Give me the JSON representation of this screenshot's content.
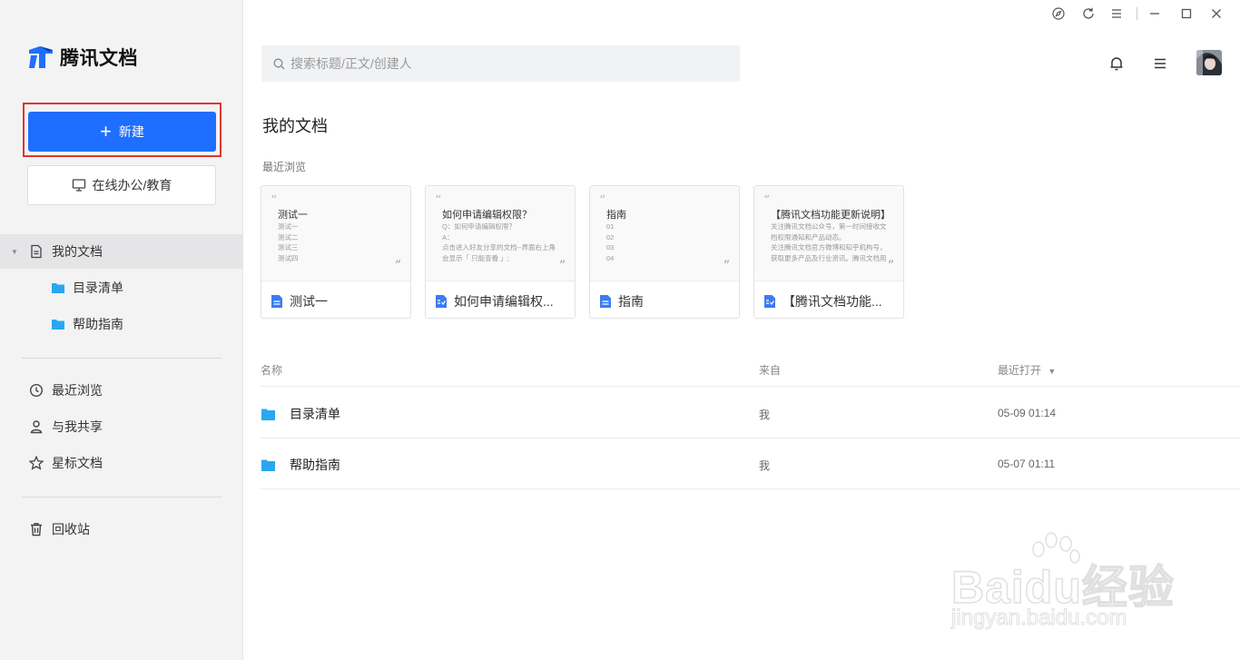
{
  "app": {
    "logo_text": "腾讯文档"
  },
  "sidebar": {
    "new_label": "新建",
    "online_label": "在线办公/教育",
    "my_docs": "我的文档",
    "folders": [
      "目录清单",
      "帮助指南"
    ],
    "nav": [
      "最近浏览",
      "与我共享",
      "星标文档"
    ],
    "trash": "回收站"
  },
  "search": {
    "placeholder": "搜索标题/正文/创建人"
  },
  "main": {
    "title": "我的文档",
    "recent_label": "最近浏览",
    "cards": [
      {
        "heading": "测试一",
        "lines": [
          "测试一",
          "测试二",
          "测试三",
          "测试四"
        ],
        "name": "测试一",
        "doc_type": "doc"
      },
      {
        "heading": "如何申请编辑权限？",
        "lines": [
          "Q：如何申请编辑权限？",
          "A：",
          "点击进入好友分享的文档--界面右上角",
          "会显示「 只能查看 」;"
        ],
        "name": "如何申请编辑权...",
        "doc_type": "form"
      },
      {
        "heading": "指南",
        "lines": [
          "01",
          "02",
          "03",
          "04"
        ],
        "name": "指南",
        "doc_type": "doc"
      },
      {
        "heading": "【腾讯文档功能更新说明】",
        "lines": [
          "关注腾讯文档公众号，第一时间接收文",
          "档权限通知和产品动态。",
          "关注腾讯文档官方微博和知乎机构号，",
          "获取更多产品及行业资讯。腾讯文档用"
        ],
        "name": "【腾讯文档功能...",
        "doc_type": "form"
      }
    ],
    "columns": {
      "name": "名称",
      "from": "来自",
      "opened": "最近打开"
    },
    "rows": [
      {
        "name": "目录清单",
        "from": "我",
        "time": "05-09 01:14"
      },
      {
        "name": "帮助指南",
        "from": "我",
        "time": "05-07 01:11"
      }
    ]
  },
  "watermark": {
    "big": "Baidu经验",
    "small": "jingyan.baidu.com"
  },
  "colors": {
    "accent": "#1e6fff",
    "highlight_border": "#e0362c",
    "folder": "#2aa7f0",
    "doc_icon": "#3b7bf5"
  }
}
